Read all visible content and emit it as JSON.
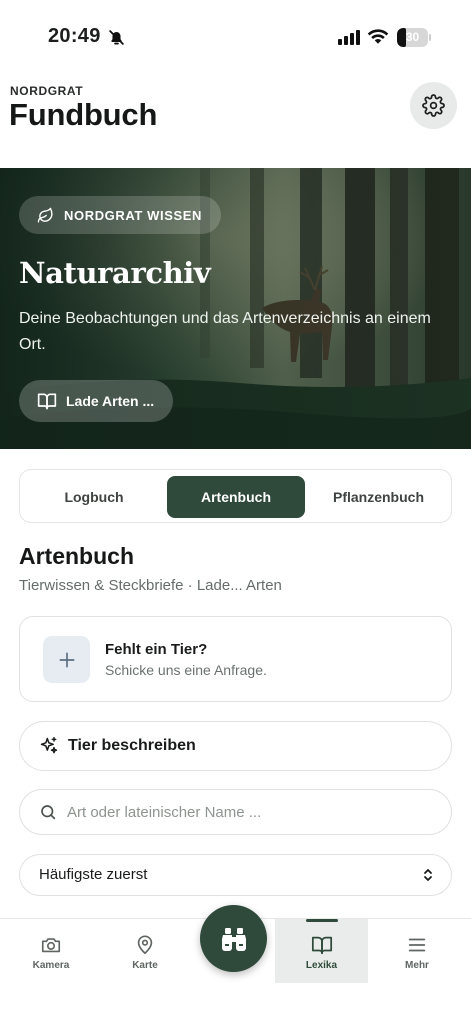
{
  "status_bar": {
    "time": "20:49",
    "battery_level": "30"
  },
  "header": {
    "eyebrow": "NORDGRAT",
    "title": "Fundbuch"
  },
  "hero": {
    "chip_label": "NORDGRAT WISSEN",
    "title": "Naturarchiv",
    "description": "Deine Beobachtungen und das Artenverzeichnis an einem Ort.",
    "button_label": "Lade Arten ..."
  },
  "tabs": [
    {
      "label": "Logbuch",
      "active": false
    },
    {
      "label": "Artenbuch",
      "active": true
    },
    {
      "label": "Pflanzenbuch",
      "active": false
    }
  ],
  "section": {
    "title": "Artenbuch",
    "subtitle": "Tierwissen & Steckbriefe · Lade... Arten"
  },
  "request_card": {
    "title": "Fehlt ein Tier?",
    "subtitle": "Schicke uns eine Anfrage."
  },
  "describe_button": {
    "label": "Tier beschreiben"
  },
  "search": {
    "placeholder": "Art oder lateinischer Name ...",
    "value": ""
  },
  "sort": {
    "selected": "Häufigste zuerst"
  },
  "bottom_nav": {
    "items": [
      {
        "label": "Kamera",
        "icon": "camera-icon"
      },
      {
        "label": "Karte",
        "icon": "map-pin-icon"
      },
      {
        "label": "Lexika",
        "icon": "book-icon",
        "active": true
      },
      {
        "label": "Mehr",
        "icon": "menu-icon"
      }
    ],
    "center_button_icon": "binoculars-icon"
  },
  "colors": {
    "accent": "#2f4a3b",
    "hero_dark": "#1f3428",
    "text_primary": "#161817",
    "text_muted": "#666d69"
  }
}
